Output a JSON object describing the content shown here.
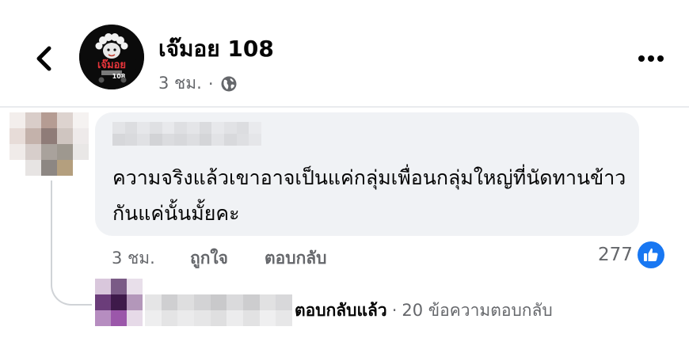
{
  "post": {
    "page_name": "เจ๊มอย 108",
    "time": "3 ชม.",
    "separator": "·",
    "avatar_text": "เจ๊มอย",
    "avatar_subtext": "108"
  },
  "comment": {
    "text": "ความจริงแล้วเขาอาจเป็นแค่กลุ่มเพื่อนกลุ่มใหญ่ที่นัดทานข้าวกันแค่นั้นมั้ยคะ",
    "time": "3 ชม.",
    "like_label": "ถูกใจ",
    "reply_label": "ตอบกลับ",
    "reaction_count": "277"
  },
  "replies": {
    "replied_label": "ตอบกลับแล้ว",
    "separator": "·",
    "count_label": "20 ข้อความตอบกลับ"
  },
  "colors": {
    "accent": "#1877f2",
    "muted_text": "#65676b",
    "bubble_bg": "#f0f2f5"
  },
  "icons": {
    "back": "chevron-left-icon",
    "more": "more-horizontal-icon",
    "audience": "globe-icon",
    "reaction": "like-thumb-icon"
  }
}
